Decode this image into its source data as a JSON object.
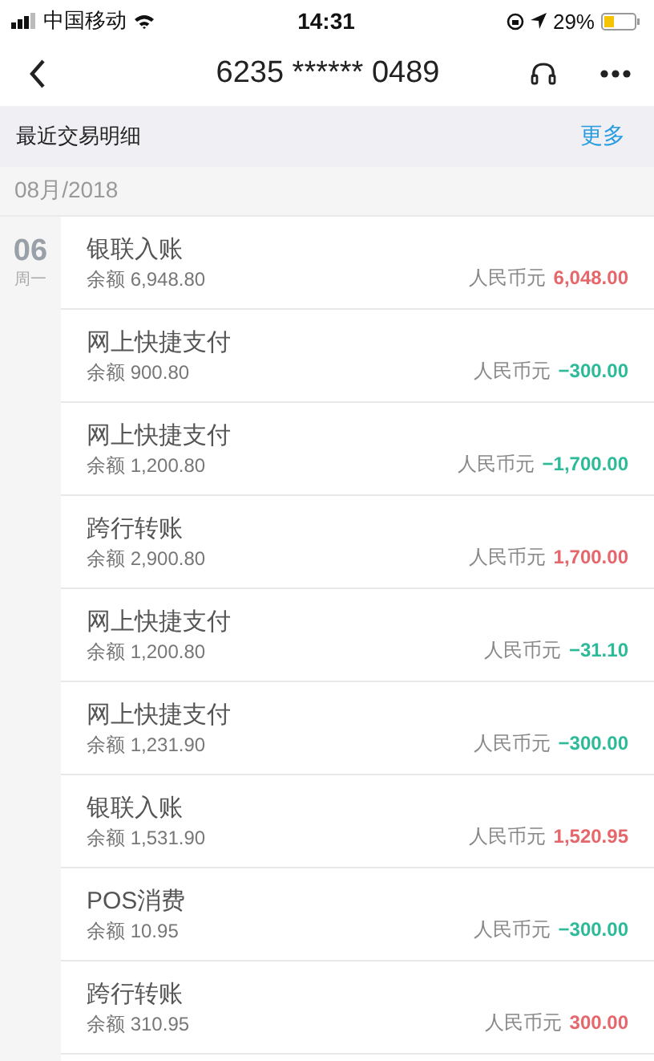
{
  "status_bar": {
    "carrier": "中国移动",
    "time": "14:31",
    "battery_percent": "29%"
  },
  "nav_bar": {
    "title": "6235 ****** 0489"
  },
  "section": {
    "title": "最近交易明细",
    "more_link": "更多"
  },
  "month": "08月/2018",
  "day": {
    "date": "06",
    "weekday": "周一"
  },
  "transactions": [
    {
      "description": "银联入账",
      "balance": "余额 6,948.80",
      "currency": "人民币元",
      "amount": "6,048.00",
      "kind": "income"
    },
    {
      "description": "网上快捷支付",
      "balance": "余额 900.80",
      "currency": "人民币元",
      "amount": "−300.00",
      "kind": "expense"
    },
    {
      "description": "网上快捷支付",
      "balance": "余额 1,200.80",
      "currency": "人民币元",
      "amount": "−1,700.00",
      "kind": "expense"
    },
    {
      "description": "跨行转账",
      "balance": "余额 2,900.80",
      "currency": "人民币元",
      "amount": "1,700.00",
      "kind": "income"
    },
    {
      "description": "网上快捷支付",
      "balance": "余额 1,200.80",
      "currency": "人民币元",
      "amount": "−31.10",
      "kind": "expense"
    },
    {
      "description": "网上快捷支付",
      "balance": "余额 1,231.90",
      "currency": "人民币元",
      "amount": "−300.00",
      "kind": "expense"
    },
    {
      "description": "银联入账",
      "balance": "余额 1,531.90",
      "currency": "人民币元",
      "amount": "1,520.95",
      "kind": "income"
    },
    {
      "description": "POS消费",
      "balance": "余额 10.95",
      "currency": "人民币元",
      "amount": "−300.00",
      "kind": "expense"
    },
    {
      "description": "跨行转账",
      "balance": "余额 310.95",
      "currency": "人民币元",
      "amount": "300.00",
      "kind": "income"
    }
  ]
}
